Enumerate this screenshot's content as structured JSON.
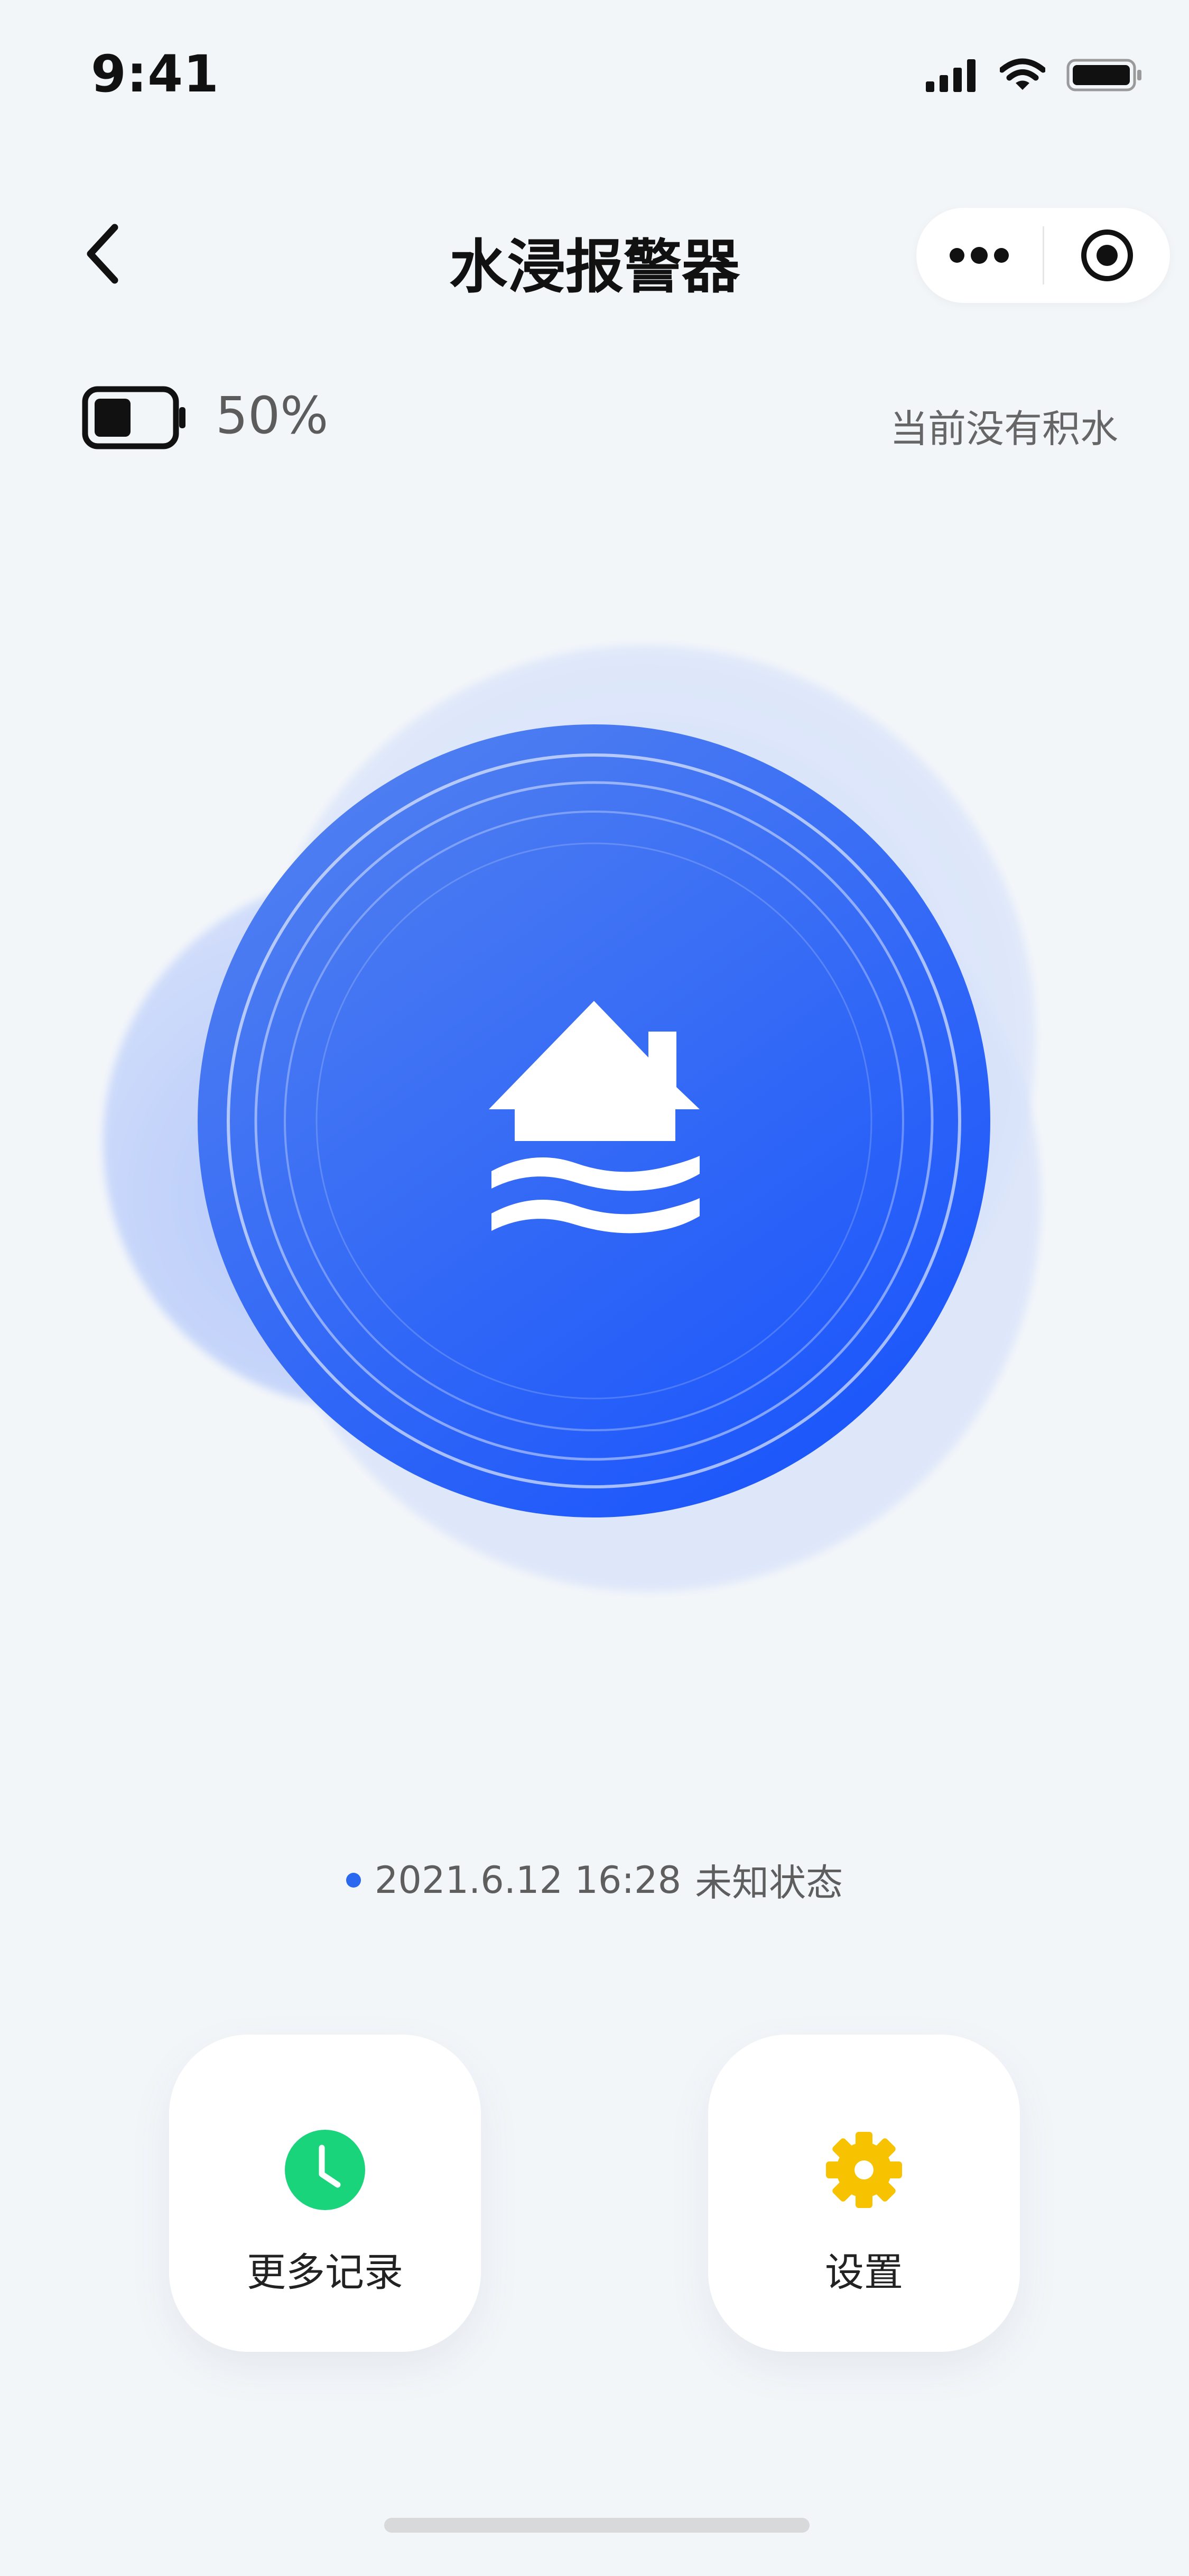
{
  "status_bar": {
    "time": "9:41"
  },
  "nav": {
    "title": "水浸报警器",
    "back_icon": "chevron-left-icon",
    "more_icon": "more-dots-icon",
    "target_icon": "target-icon"
  },
  "device": {
    "battery_percent_text": "50%",
    "battery_level": 0.5,
    "water_status": "当前没有积水",
    "hero_icon": "flood-house-icon"
  },
  "last_event": {
    "timestamp": "2021.6.12 16:28",
    "status": "未知状态"
  },
  "actions": {
    "records_label": "更多记录",
    "records_icon": "clock-icon",
    "settings_label": "设置",
    "settings_icon": "gear-icon"
  },
  "colors": {
    "primary_blue": "#2a68f0",
    "records_green": "#19d47a",
    "settings_yellow": "#f7c300",
    "background": "#f3f6f9"
  }
}
